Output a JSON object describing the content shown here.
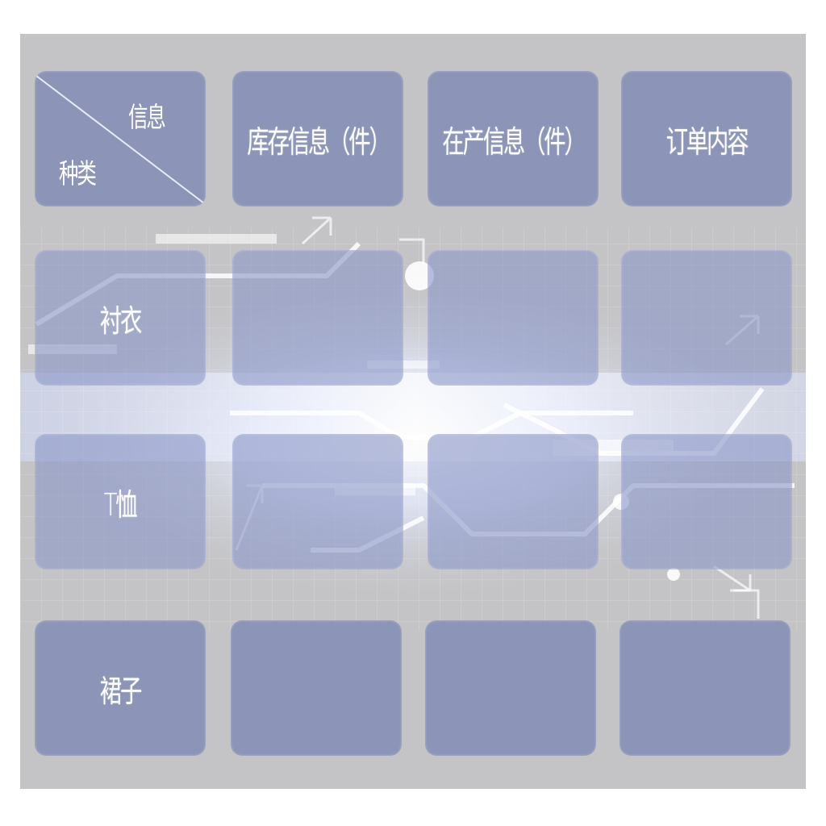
{
  "table": {
    "corner": {
      "top_label": "信息",
      "bottom_label": "种类"
    },
    "headers": [
      "库存信息（件）",
      "在产信息（件）",
      "订单内容"
    ],
    "rows": [
      {
        "label": "衬衣",
        "cells": [
          "",
          "",
          ""
        ]
      },
      {
        "label": "T恤",
        "cells": [
          "",
          "",
          ""
        ]
      },
      {
        "label": "裙子",
        "cells": [
          "",
          "",
          ""
        ]
      }
    ]
  },
  "colors": {
    "panel_background": "#c4c4c6",
    "cell_fill": "#7c88b2",
    "text": "#ffffff",
    "glow": "#eaf0ff"
  }
}
